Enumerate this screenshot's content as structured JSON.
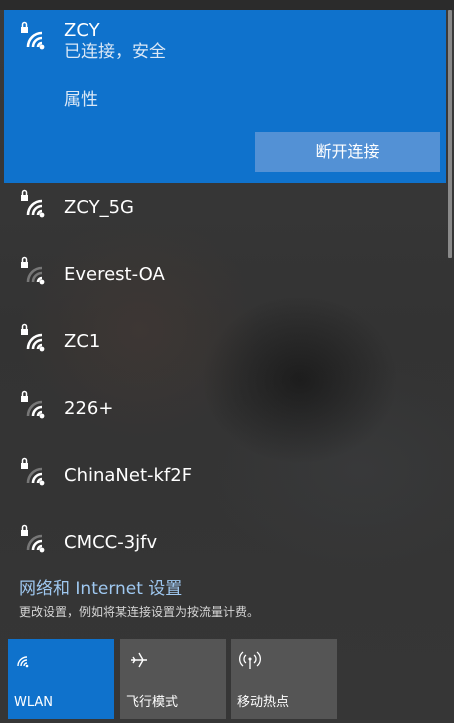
{
  "selected_network": {
    "name": "ZCY",
    "status": "已连接，安全",
    "properties_link": "属性",
    "disconnect_button": "断开连接"
  },
  "networks": [
    {
      "name": "ZCY_5G",
      "icon": "wifi-secured-icon"
    },
    {
      "name": "Everest-OA",
      "icon": "wifi-secured-weak-icon"
    },
    {
      "name": "ZC1",
      "icon": "wifi-secured-icon"
    },
    {
      "name": "226+",
      "icon": "wifi-secured-icon"
    },
    {
      "name": "ChinaNet-kf2F",
      "icon": "wifi-secured-icon"
    },
    {
      "name": "CMCC-3jfv",
      "icon": "wifi-secured-icon"
    }
  ],
  "settings": {
    "link": "网络和 Internet 设置",
    "description": "更改设置，例如将某连接设置为按流量计费。"
  },
  "quick_actions": [
    {
      "label": "WLAN",
      "icon": "wifi-icon",
      "active": true
    },
    {
      "label": "飞行模式",
      "icon": "airplane-icon",
      "active": false
    },
    {
      "label": "移动热点",
      "icon": "hotspot-icon",
      "active": false
    }
  ],
  "colors": {
    "accent": "#0f72cc",
    "button": "#5391d5",
    "tile_inactive": "#555555",
    "link": "#9fc8f0"
  }
}
